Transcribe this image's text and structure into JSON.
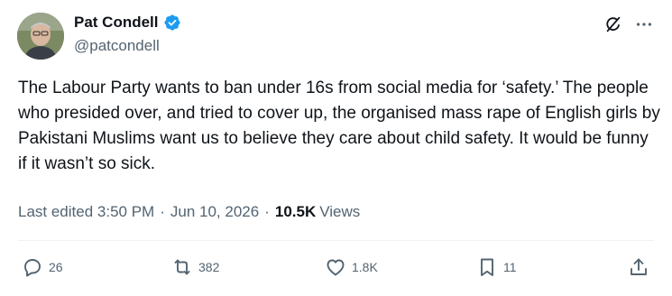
{
  "author": {
    "display_name": "Pat Condell",
    "handle": "@patcondell",
    "verified": true
  },
  "tweet": {
    "text": "The Labour Party wants to ban under 16s from social media for ‘safety.’ The people who presided over, and tried to cover up, the organised mass rape of English girls by Pakistani Muslims want us to believe they care about child safety. It would be funny if it wasn’t so sick."
  },
  "meta": {
    "edited_time": "Last edited 3:50 PM",
    "separator": "·",
    "date": "Jun 10, 2026",
    "views_count": "10.5K",
    "views_label": "Views"
  },
  "actions": {
    "replies": "26",
    "reposts": "382",
    "likes": "1.8K",
    "bookmarks": "11"
  },
  "icons": {
    "top": [
      "grok-icon",
      "more-icon"
    ],
    "actions": [
      "reply-icon",
      "repost-icon",
      "like-icon",
      "bookmark-icon",
      "share-icon"
    ]
  },
  "colors": {
    "text": "#0f1419",
    "secondary": "#536471",
    "verified": "#1d9bf0",
    "divider": "#eff3f4"
  }
}
